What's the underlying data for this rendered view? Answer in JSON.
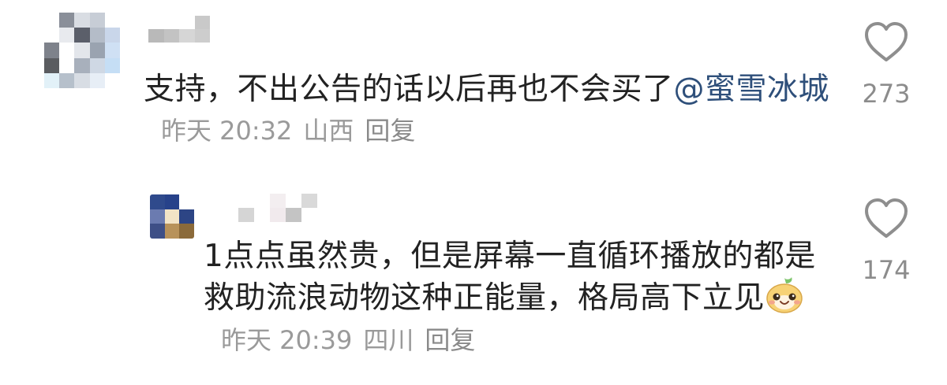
{
  "comments": [
    {
      "text": "支持，不出公告的话以后再也不会买了",
      "mention": "@蜜雪冰城",
      "time": "昨天 20:32",
      "location": "山西",
      "reply_label": "回复",
      "likes": "273",
      "like_icon": "heart-outline-icon"
    },
    {
      "text": "1点点虽然贵，但是屏幕一直循环播放的都是救助流浪动物这种正能量，格局高下立见",
      "emoji": "smiling-blob-emoji",
      "time": "昨天 20:39",
      "location": "四川",
      "reply_label": "回复",
      "likes": "174",
      "like_icon": "heart-outline-icon"
    }
  ],
  "colors": {
    "text": "#222222",
    "mention": "#2e4f7a",
    "meta": "#9a9a9a",
    "like_count": "#8c8c8c"
  }
}
